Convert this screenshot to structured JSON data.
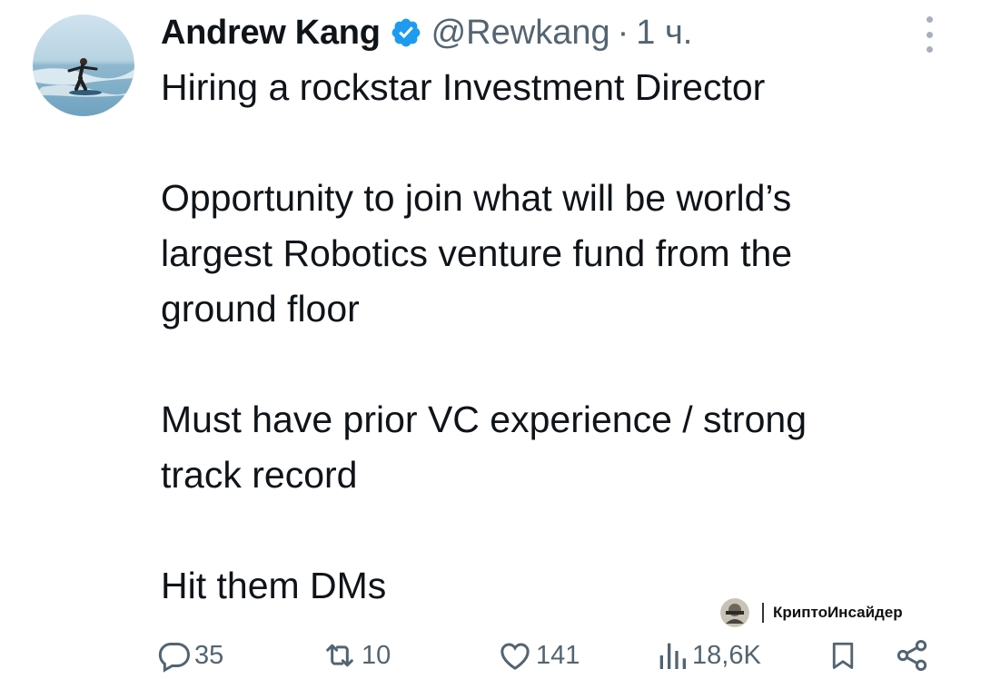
{
  "tweet": {
    "author_name": "Andrew Kang",
    "handle": "@Rewkang",
    "separator": "·",
    "time": "1 ч.",
    "verified": true,
    "paragraphs": [
      [
        "Hiring a rockstar Investment Director"
      ],
      [
        "Opportunity to join what will be world’s",
        "largest Robotics venture fund from the",
        "ground floor"
      ],
      [
        "Must have prior VC experience / strong",
        "track record"
      ],
      [
        "Hit them DMs"
      ]
    ]
  },
  "actions": {
    "replies": "35",
    "retweets": "10",
    "likes": "141",
    "views": "18,6K"
  },
  "watermark": {
    "text": "КриптоИнсайдер"
  },
  "colors": {
    "verified_badge": "#1d9bf0",
    "secondary_text": "#536471",
    "primary_text": "#0f1419"
  },
  "icons": [
    "verified-badge-icon",
    "more-options-icon",
    "reply-icon",
    "retweet-icon",
    "like-icon",
    "views-icon",
    "bookmark-icon",
    "share-icon"
  ]
}
